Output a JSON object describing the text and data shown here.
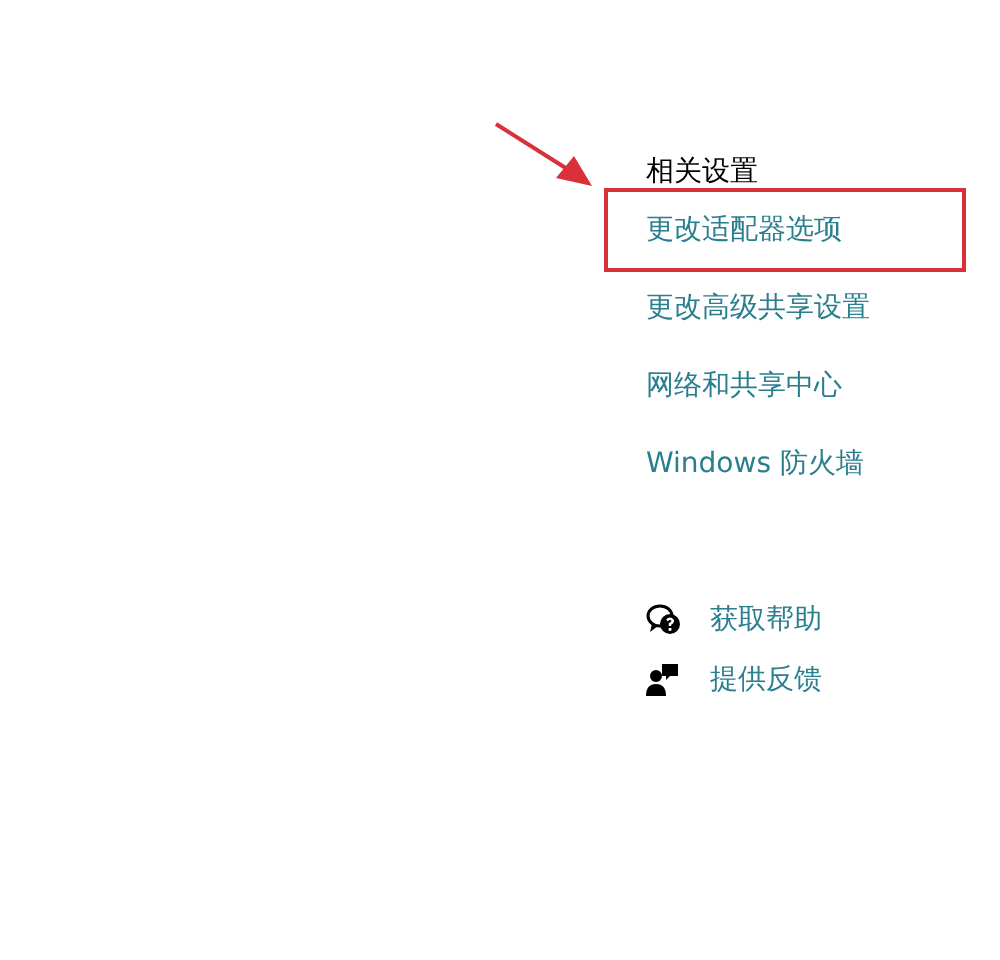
{
  "related_settings": {
    "heading": "相关设置",
    "links": [
      {
        "label": "更改适配器选项",
        "highlighted": true
      },
      {
        "label": "更改高级共享设置",
        "highlighted": false
      },
      {
        "label": "网络和共享中心",
        "highlighted": false
      },
      {
        "label": "Windows 防火墙",
        "highlighted": false
      }
    ]
  },
  "help_links": [
    {
      "kind": "help",
      "label": "获取帮助"
    },
    {
      "kind": "feedback",
      "label": "提供反馈"
    }
  ]
}
